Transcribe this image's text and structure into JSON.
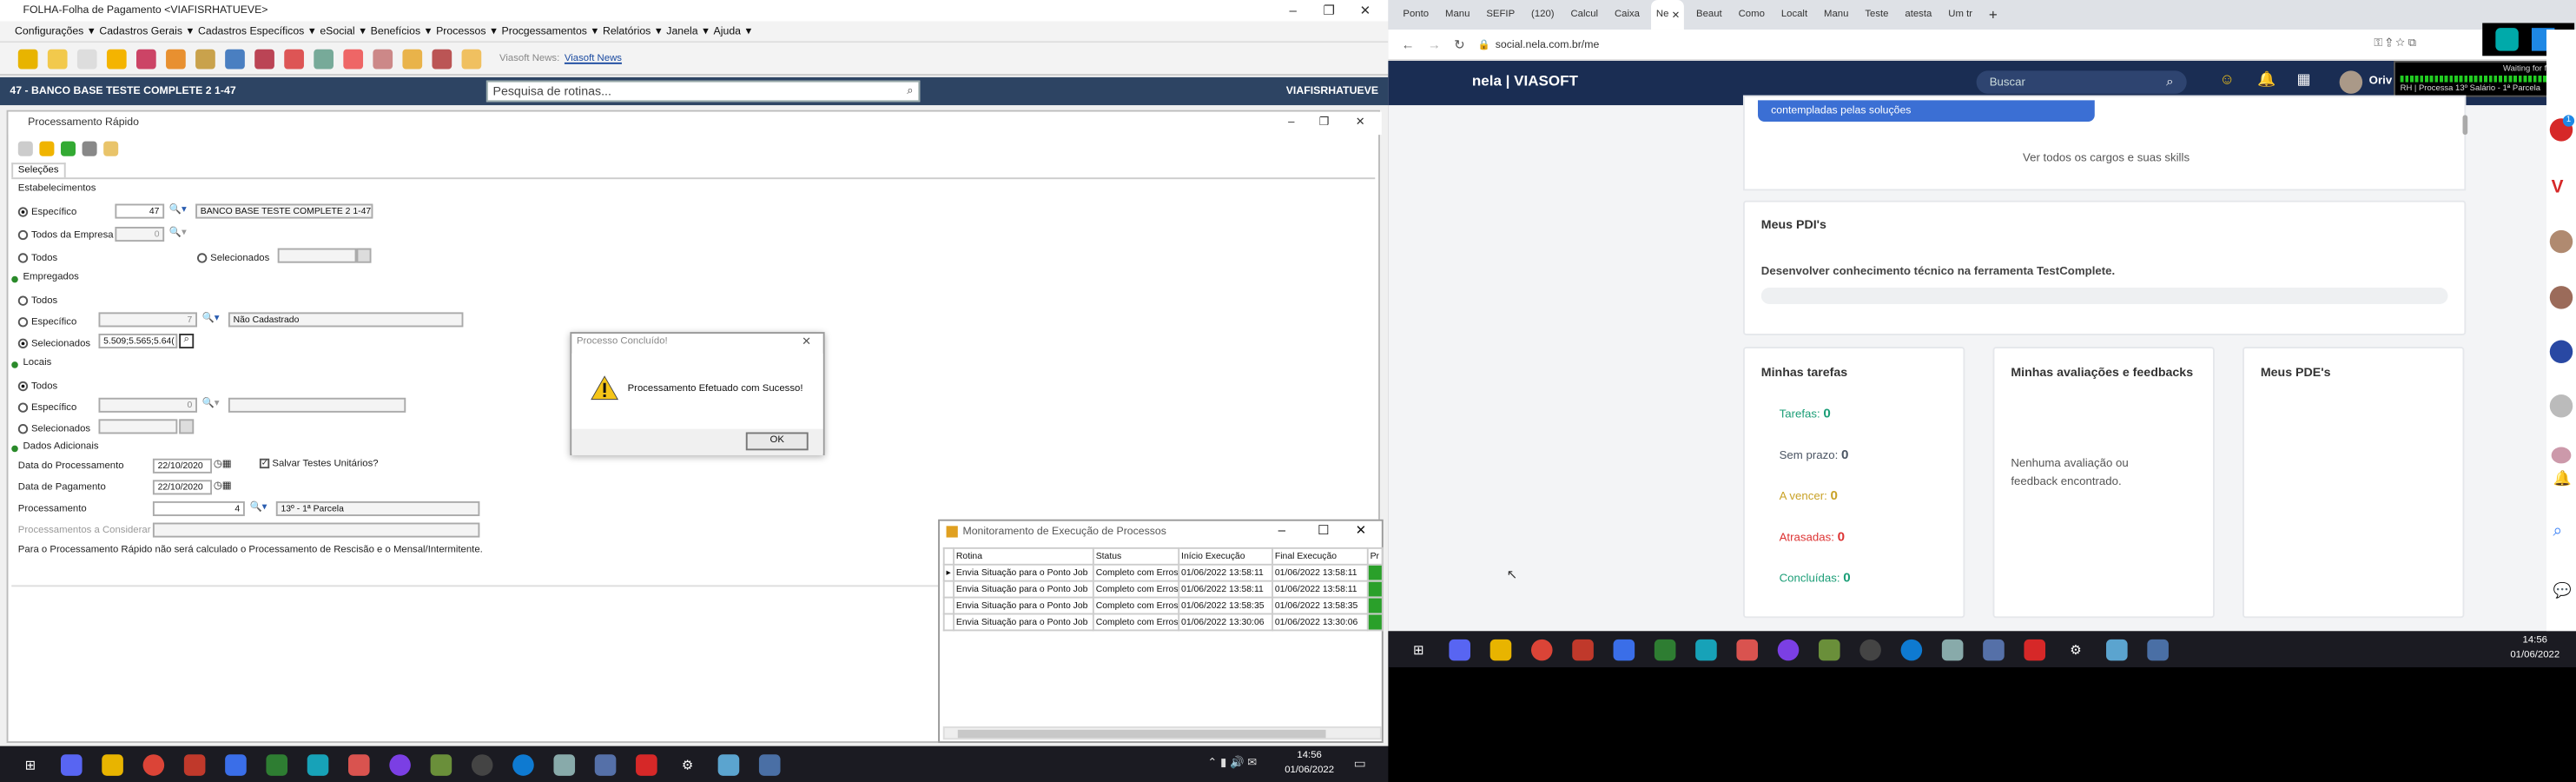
{
  "app": {
    "window_title": "FOLHA-Folha de Pagamento <VIAFISRHATUEVE>",
    "menu": [
      "Configurações",
      "Cadastros Gerais",
      "Cadastros Específicos",
      "eSocial",
      "Benefícios",
      "Processos",
      "Procgessamentos",
      "Relatórios",
      "Janela",
      "Ajuda"
    ],
    "news_label": "Viasoft News:",
    "news_link": "Viasoft News",
    "bank": "47 - BANCO BASE TESTE COMPLETE 2 1-47",
    "user": "VIAFISRHATUEVE",
    "search_placeholder": "Pesquisa de rotinas...",
    "child_title": "Processamento Rápido",
    "tab": "Seleções",
    "estab": {
      "title": "Estabelecimentos",
      "esp": "Específico",
      "esp_code": "47",
      "esp_name": "BANCO BASE TESTE COMPLETE 2 1-47",
      "todos_empresa": "Todos da Empresa",
      "todos_empresa_code": "0",
      "todos": "Todos",
      "selecionados": "Selecionados"
    },
    "emp": {
      "title": "Empregados",
      "todos": "Todos",
      "esp": "Específico",
      "esp_code": "7",
      "esp_name": "Não Cadastrado",
      "sel": "Selecionados",
      "sel_value": "5.509;5.565;5.64("
    },
    "locais": {
      "title": "Locais",
      "todos": "Todos",
      "esp": "Específico",
      "esp_code": "0",
      "sel": "Selecionados"
    },
    "dados": {
      "title": "Dados Adicionais",
      "data_proc_label": "Data do Processamento",
      "data_proc": "22/10/2020",
      "salvar": "Salvar Testes Unitários?",
      "data_pag_label": "Data de Pagamento",
      "data_pag": "22/10/2020",
      "proc_label": "Processamento",
      "proc_code": "4",
      "proc_name": "13º - 1ª Parcela",
      "considerar": "Processamentos a Considerar"
    },
    "note": "Para o Processamento Rápido não será calculado o Processamento de Rescisão e o Mensal/Intermitente.",
    "dialog": {
      "title": "Processo Concluído!",
      "message": "Processamento Efetuado com Sucesso!",
      "ok": "OK"
    },
    "monitor": {
      "title": "Monitoramento de Execução de Processos",
      "headers": [
        "Rotina",
        "Status",
        "Início Execução",
        "Final Execução",
        "Pr"
      ],
      "rows": [
        [
          "Envia Situação para o Ponto Job",
          "Completo com Erros",
          "01/06/2022 13:58:11",
          "01/06/2022 13:58:11"
        ],
        [
          "Envia Situação para o Ponto Job",
          "Completo com Erros",
          "01/06/2022 13:58:11",
          "01/06/2022 13:58:11"
        ],
        [
          "Envia Situação para o Ponto Job",
          "Completo com Erros",
          "01/06/2022 13:58:35",
          "01/06/2022 13:58:35"
        ],
        [
          "Envia Situação para o Ponto Job",
          "Completo com Erros",
          "01/06/2022 13:30:06",
          "01/06/2022 13:30:06"
        ]
      ]
    },
    "clock": {
      "time": "14:56",
      "date": "01/06/2022"
    }
  },
  "browser": {
    "tabs": [
      "Ponto",
      "Manu",
      "SEFIP",
      "(120)",
      "Calcul",
      "Caixa",
      "Ne",
      "Beaut",
      "Como",
      "Localt",
      "Manu",
      "Teste",
      "atesta",
      "Um tr"
    ],
    "url": "social.nela.com.br/me",
    "brand": "nela | VIASOFT",
    "search": "Buscar",
    "user": "Oriv",
    "ext_status": "Waiting for findSel",
    "ext_process": "RH | Processa 13º Salário - 1ª Parcela",
    "banner": "contempladas pelas soluções",
    "ver_todos": "Ver todos os cargos e suas skills",
    "pdi_title": "Meus PDI's",
    "pdi_item": "Desenvolver conhecimento técnico na ferramenta TestComplete.",
    "tarefas_title": "Minhas tarefas",
    "tarefas": [
      {
        "label": "Tarefas:",
        "value": "0",
        "color": "#1b9e77"
      },
      {
        "label": "Sem prazo:",
        "value": "0",
        "color": "#4b5563"
      },
      {
        "label": "A vencer:",
        "value": "0",
        "color": "#c9a227"
      },
      {
        "label": "Atrasadas:",
        "value": "0",
        "color": "#d33"
      },
      {
        "label": "Concluídas:",
        "value": "0",
        "color": "#1b9e77"
      }
    ],
    "aval_title": "Minhas avaliações e feedbacks",
    "aval_empty": "Nenhuma avaliação ou feedback encontrado.",
    "pde_title": "Meus PDE's",
    "clock": {
      "time": "14:56",
      "date": "01/06/2022"
    },
    "badge": "1"
  }
}
